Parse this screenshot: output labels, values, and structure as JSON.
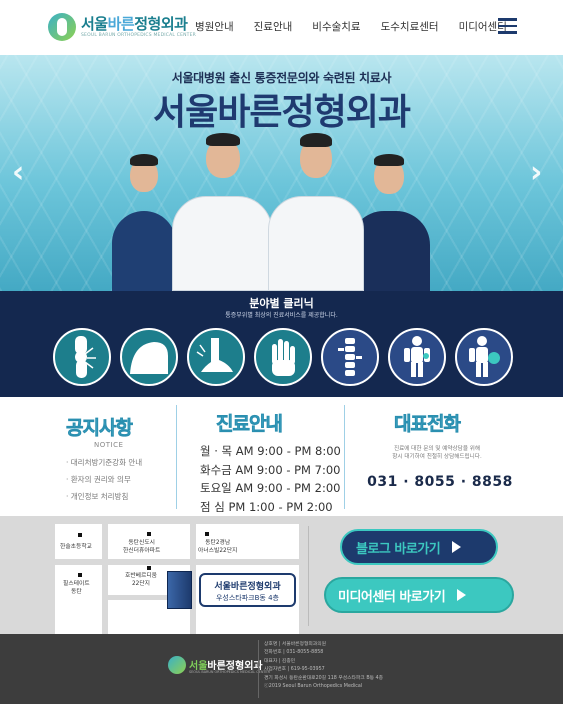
{
  "header": {
    "logo_text_main": "서울",
    "logo_text_accent": "바른",
    "logo_text_rest": "정형외과",
    "logo_sub": "SEOUL BARUN ORTHOPEDICS MEDICAL CENTER",
    "nav": [
      "병원안내",
      "진료안내",
      "비수술치료",
      "도수치료센터",
      "미디어센터"
    ],
    "menu_icon": "hamburger-icon"
  },
  "hero": {
    "tagline": "서울대병원 출신 통증전문의와 숙련된 치료사",
    "title": "서울바른정형외과",
    "prev_icon": "chevron-left-icon",
    "next_icon": "chevron-right-icon"
  },
  "clinic": {
    "title": "분야별 클리닉",
    "subtitle": "통증부위별 최상의 진료서비스를 제공합니다.",
    "icons": [
      "knee-icon",
      "shoulder-icon",
      "ankle-icon",
      "hand-icon",
      "spine-icon",
      "body-pain-icon",
      "sports-injury-icon"
    ]
  },
  "notice": {
    "title": "공지사항",
    "label": "NOTICE",
    "items": [
      "· 대리처방기준강화 안내",
      "· 환자의 권리와 의무",
      "· 개인정보 처리방침"
    ]
  },
  "hours": {
    "title": "진료안내",
    "rows": [
      "월 · 목  AM 9:00 - PM 8:00",
      "화수금  AM 9:00 - PM 7:00",
      "토요일  AM 9:00 - PM 2:00",
      "점   심  PM 1:00 - PM 2:00"
    ]
  },
  "contact": {
    "title": "대표전화",
    "desc_line1": "진료에 대한 문의 및 예약상담을 위해",
    "desc_line2": "항시 대기하여 친절히 상담해드립니다.",
    "phone": "031 · 8055 · 8858"
  },
  "map": {
    "labels": {
      "school": "한솔초등학교",
      "apt1_l1": "동탄신도시",
      "apt1_l2": "한신더휴아파트",
      "apt2_l1": "동탄2경남",
      "apt2_l2": "아너스빌22단지",
      "hills_l1": "힐스테이트",
      "hills_l2": "동탄",
      "hoban_l1": "호반베르디움",
      "hoban_l2": "22단지"
    },
    "pin_title": "서울바른정형외과",
    "pin_address": "우성스타파크B동 4층"
  },
  "buttons": {
    "blog": "블로그 바로가기",
    "media": "미디어센터 바로가기",
    "blog_color": "#1d3a6d",
    "media_color": "#3cc8c0"
  },
  "footer": {
    "logo_accent": "서울",
    "logo_rest": "바른정형외과",
    "logo_sub": "SEOUL BARUN ORTHOPEDICS MEDICAL CENTER",
    "lines": [
      "상호명 | 서울바른정형외과의원",
      "전화번호 | 031-8055-8858",
      "대표자 | 김종민",
      "사업자번호 | 619-95-03957",
      "경기 화성시 동탄순환대로20길 118 우성스타파크 B동 4층",
      "ⓒ2019 Seoul Barun Orthopedics Medical"
    ]
  }
}
